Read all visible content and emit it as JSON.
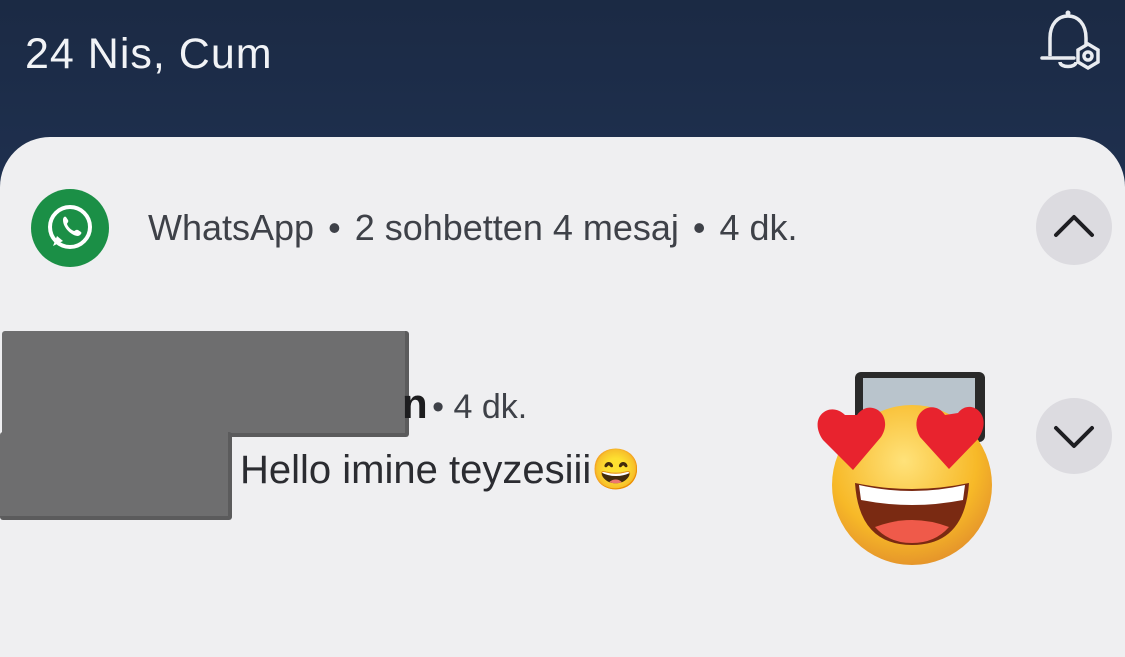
{
  "status_bar": {
    "date": "24 Nis, Cum",
    "settings_icon": "notification-settings-icon"
  },
  "notification": {
    "app_icon": "whatsapp-icon",
    "app_name": "WhatsApp",
    "separator": "•",
    "summary": "2 sohbetten 4 mesaj",
    "time": "4 dk.",
    "collapse_icon": "chevron-up-icon",
    "message": {
      "sender_visible_fragment": "n",
      "time": "• 4 dk.",
      "text": "Hello imine teyzesiii",
      "text_emoji": "😄",
      "expand_icon": "chevron-down-icon",
      "thumbnail": "image-thumbnail",
      "sticker": "heart-eyes-emoji"
    }
  },
  "colors": {
    "background_top": "#1b2a44",
    "panel": "#efeff1",
    "whatsapp_green": "#1b8f46",
    "button_bg": "#dcdbe0",
    "redaction": "#6e6e6f"
  }
}
